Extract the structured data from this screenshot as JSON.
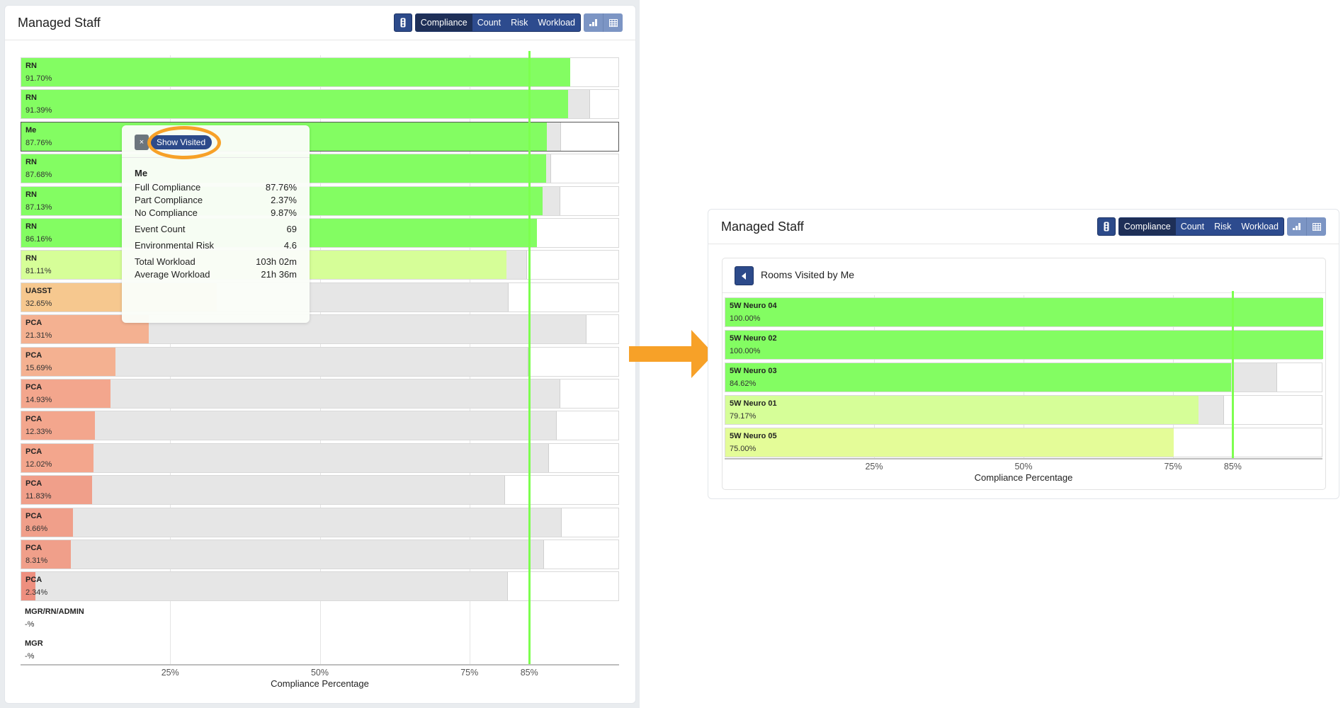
{
  "colors": {
    "high": "#83fd62",
    "mid": "#d6fe98",
    "mid2": "#e4fc98",
    "amber": "#f6c88f",
    "salmon1": "#f4b191",
    "salmon2": "#f3a68d",
    "salmon3": "#f09f8a",
    "salmon4": "#ee8f7f",
    "target": "#7dff4f",
    "callout": "#f7a128",
    "primary": "#2c4a8a"
  },
  "left_panel": {
    "title": "Managed Staff",
    "toolbar": {
      "filter_icon": "traffic-light-icon",
      "modes": [
        "Compliance",
        "Count",
        "Risk",
        "Workload"
      ],
      "active_mode": "Compliance",
      "views": [
        "bar-chart-icon",
        "table-icon"
      ]
    },
    "tooltip": {
      "close_label": "×",
      "show_visited_label": "Show Visited",
      "name": "Me",
      "rows": [
        {
          "label": "Full Compliance",
          "value": "87.76%"
        },
        {
          "label": "Part Compliance",
          "value": "2.37%"
        },
        {
          "label": "No Compliance",
          "value": "9.87%"
        },
        {
          "label": "Event Count",
          "value": "69"
        },
        {
          "label": "Environmental Risk",
          "value": "4.6"
        },
        {
          "label": "Total Workload",
          "value": "103h 02m"
        },
        {
          "label": "Average Workload",
          "value": "21h 36m"
        }
      ]
    }
  },
  "right_panel": {
    "title": "Managed Staff",
    "toolbar": {
      "filter_icon": "traffic-light-icon",
      "modes": [
        "Compliance",
        "Count",
        "Risk",
        "Workload"
      ],
      "active_mode": "Compliance",
      "views": [
        "bar-chart-icon",
        "table-icon"
      ]
    },
    "card_title": "Rooms Visited by Me",
    "back_icon": "caret-left-icon"
  },
  "chart_data": [
    {
      "type": "bar",
      "orientation": "horizontal-stacked",
      "title": "Managed Staff",
      "xlabel": "Compliance Percentage",
      "xlim": [
        0,
        100
      ],
      "ticks": [
        "25%",
        "50%",
        "75%",
        "85%"
      ],
      "tick_values": [
        25,
        50,
        75,
        85
      ],
      "target_line": 85,
      "series_names": [
        "Full Compliance",
        "Part Compliance"
      ],
      "rows": [
        {
          "label": "RN",
          "value_label": "91.70%",
          "full": 91.7,
          "part": 0,
          "color": "high"
        },
        {
          "label": "RN",
          "value_label": "91.39%",
          "full": 91.39,
          "part": 3.6,
          "color": "high"
        },
        {
          "label": "Me",
          "value_label": "87.76%",
          "full": 87.76,
          "part": 2.37,
          "color": "high",
          "selected": true
        },
        {
          "label": "RN",
          "value_label": "87.68%",
          "full": 87.68,
          "part": 0.9,
          "color": "high"
        },
        {
          "label": "RN",
          "value_label": "87.13%",
          "full": 87.13,
          "part": 2.9,
          "color": "high"
        },
        {
          "label": "RN",
          "value_label": "86.16%",
          "full": 86.16,
          "part": 0,
          "color": "high"
        },
        {
          "label": "RN",
          "value_label": "81.11%",
          "full": 81.11,
          "part": 3.4,
          "color": "mid"
        },
        {
          "label": "UASST",
          "value_label": "32.65%",
          "full": 32.65,
          "part": 48.8,
          "color": "amber"
        },
        {
          "label": "PCA",
          "value_label": "21.31%",
          "full": 21.31,
          "part": 73.1,
          "color": "salmon1"
        },
        {
          "label": "PCA",
          "value_label": "15.69%",
          "full": 15.69,
          "part": 69.0,
          "color": "salmon1"
        },
        {
          "label": "PCA",
          "value_label": "14.93%",
          "full": 14.93,
          "part": 75.1,
          "color": "salmon2"
        },
        {
          "label": "PCA",
          "value_label": "12.33%",
          "full": 12.33,
          "part": 77.1,
          "color": "salmon2"
        },
        {
          "label": "PCA",
          "value_label": "12.02%",
          "full": 12.02,
          "part": 76.2,
          "color": "salmon2"
        },
        {
          "label": "PCA",
          "value_label": "11.83%",
          "full": 11.83,
          "part": 69.0,
          "color": "salmon3"
        },
        {
          "label": "PCA",
          "value_label": "8.66%",
          "full": 8.66,
          "part": 81.6,
          "color": "salmon3"
        },
        {
          "label": "PCA",
          "value_label": "8.31%",
          "full": 8.31,
          "part": 79.0,
          "color": "salmon3"
        },
        {
          "label": "PCA",
          "value_label": "2.34%",
          "full": 2.34,
          "part": 79.0,
          "color": "salmon4"
        },
        {
          "label": "MGR/RN/ADMIN",
          "value_label": "-%",
          "full": null,
          "part": null
        },
        {
          "label": "MGR",
          "value_label": "-%",
          "full": null,
          "part": null
        }
      ]
    },
    {
      "type": "bar",
      "orientation": "horizontal-stacked",
      "title": "Rooms Visited by Me",
      "xlabel": "Compliance Percentage",
      "xlim": [
        0,
        100
      ],
      "ticks": [
        "25%",
        "50%",
        "75%",
        "85%"
      ],
      "tick_values": [
        25,
        50,
        75,
        85
      ],
      "target_line": 85,
      "series_names": [
        "Full Compliance",
        "Part Compliance"
      ],
      "rows": [
        {
          "label": "5W Neuro 04",
          "value_label": "100.00%",
          "full": 100.0,
          "part": 0,
          "color": "high"
        },
        {
          "label": "5W Neuro 02",
          "value_label": "100.00%",
          "full": 100.0,
          "part": 0,
          "color": "high"
        },
        {
          "label": "5W Neuro 03",
          "value_label": "84.62%",
          "full": 84.62,
          "part": 7.7,
          "color": "high"
        },
        {
          "label": "5W Neuro 01",
          "value_label": "79.17%",
          "full": 79.17,
          "part": 4.2,
          "color": "mid"
        },
        {
          "label": "5W Neuro 05",
          "value_label": "75.00%",
          "full": 75.0,
          "part": 0,
          "color": "mid2"
        }
      ]
    }
  ]
}
